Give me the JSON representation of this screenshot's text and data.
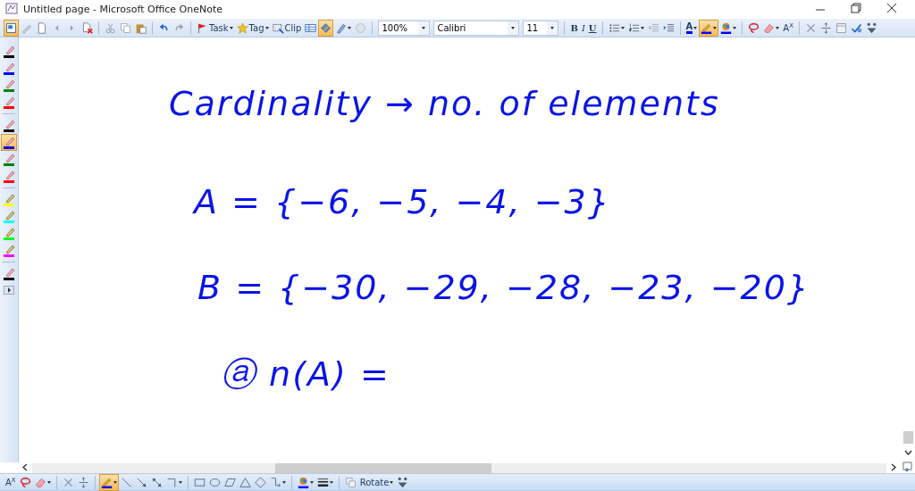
{
  "window": {
    "title": "Untitled page - Microsoft Office OneNote"
  },
  "toolbar": {
    "groups": [
      [
        {
          "kind": "icon",
          "selected": true
        },
        {
          "kind": "icon",
          "selected": false
        },
        {
          "kind": "icon",
          "selected": false
        },
        {
          "kind": "icon",
          "selected": false
        },
        {
          "kind": "icon",
          "selected": false
        },
        {
          "kind": "icon",
          "selected": false
        }
      ],
      [
        {
          "kind": "icon",
          "selected": false
        },
        {
          "kind": "icon",
          "selected": false
        },
        {
          "kind": "icon",
          "selected": false
        }
      ],
      [
        {
          "kind": "icon",
          "selected": false
        },
        {
          "kind": "icon",
          "selected": false
        }
      ],
      [
        {
          "kind": "label-dropdown",
          "label": "Task",
          "selected": false
        },
        {
          "kind": "label-dropdown",
          "label": "Tag",
          "selected": false
        },
        {
          "kind": "label",
          "label": "Clip",
          "selected": false
        },
        {
          "kind": "icon",
          "selected": false
        },
        {
          "kind": "icon",
          "selected": true
        },
        {
          "kind": "icon-dropdown",
          "selected": false
        },
        {
          "kind": "icon",
          "selected": false
        }
      ],
      [
        {
          "kind": "combo",
          "value": "100%"
        },
        {
          "kind": "combo",
          "value": "Calibri"
        },
        {
          "kind": "combo",
          "value": "11"
        }
      ],
      [
        {
          "kind": "format",
          "label": "B",
          "selected": false
        },
        {
          "kind": "format",
          "label": "I",
          "selected": false
        },
        {
          "kind": "format",
          "label": "U",
          "selected": false
        }
      ],
      [
        {
          "kind": "icon-dropdown",
          "selected": false
        },
        {
          "kind": "icon-dropdown",
          "selected": false
        },
        {
          "kind": "icon",
          "selected": false
        },
        {
          "kind": "icon",
          "selected": false
        }
      ],
      [
        {
          "kind": "text-dropdown",
          "label": "A",
          "selected": false
        },
        {
          "kind": "icon-dropdown",
          "selected": true
        },
        {
          "kind": "icon-dropdown",
          "selected": false
        }
      ],
      [
        {
          "kind": "icon",
          "selected": false
        },
        {
          "kind": "icon-dropdown",
          "selected": false
        },
        {
          "kind": "text",
          "label": "A$^{X}$",
          "selected": false
        }
      ],
      [
        {
          "kind": "icon",
          "selected": false
        },
        {
          "kind": "icon",
          "selected": false
        },
        {
          "kind": "icon",
          "selected": false
        },
        {
          "kind": "icon",
          "selected": false
        },
        {
          "kind": "icon",
          "selected": false
        }
      ]
    ]
  },
  "pens": {
    "groups": [
      [
        {
          "kind": "pen",
          "color": "#000000",
          "selected": false
        },
        {
          "kind": "pen",
          "color": "#0000ff",
          "selected": false
        },
        {
          "kind": "pen",
          "color": "#008000",
          "selected": false
        },
        {
          "kind": "pen",
          "color": "#ff0000",
          "selected": false
        }
      ],
      [
        {
          "kind": "pen",
          "color": "#000000",
          "selected": false
        },
        {
          "kind": "pen",
          "color": "#0000ff",
          "selected": true
        },
        {
          "kind": "pen",
          "color": "#008000",
          "selected": false
        },
        {
          "kind": "pen",
          "color": "#ff0000",
          "selected": false
        }
      ],
      [
        {
          "kind": "highlighter",
          "color": "#ffff00",
          "selected": false
        },
        {
          "kind": "highlighter",
          "color": "#00ffff",
          "selected": false
        },
        {
          "kind": "highlighter",
          "color": "#00ff00",
          "selected": false
        },
        {
          "kind": "highlighter",
          "color": "#ff00ff",
          "selected": false
        }
      ],
      [
        {
          "kind": "pen",
          "color": "#000000",
          "selected": false
        }
      ]
    ]
  },
  "ink": [
    {
      "text": "Cardinality → no. of elements"
    },
    {
      "text": "A = {−6, −5, −4, −3}"
    },
    {
      "text": "B = {−30, −29, −28, −23, −20}"
    },
    {
      "text": "ⓐ  n(A) ="
    }
  ],
  "drawing_toolbar": {
    "groups": [
      [
        {
          "kind": "text",
          "label": "A$^{X}$",
          "selected": false
        },
        {
          "kind": "icon",
          "selected": false
        },
        {
          "kind": "icon-dropdown",
          "selected": false
        }
      ],
      [
        {
          "kind": "icon",
          "selected": false
        },
        {
          "kind": "icon",
          "selected": false
        }
      ],
      [
        {
          "kind": "icon-dropdown",
          "selected": true
        },
        {
          "kind": "icon",
          "selected": false
        },
        {
          "kind": "icon",
          "selected": false
        },
        {
          "kind": "icon",
          "selected": false
        },
        {
          "kind": "icon-dropdown",
          "selected": false
        }
      ],
      [
        {
          "kind": "icon",
          "selected": false
        },
        {
          "kind": "icon",
          "selected": false
        },
        {
          "kind": "icon",
          "selected": false
        },
        {
          "kind": "icon",
          "selected": false
        },
        {
          "kind": "icon",
          "selected": false
        },
        {
          "kind": "icon-dropdown",
          "selected": false
        }
      ],
      [
        {
          "kind": "icon-dropdown",
          "selected": false
        },
        {
          "kind": "icon-dropdown",
          "selected": false
        }
      ],
      [
        {
          "kind": "icon",
          "selected": false
        },
        {
          "kind": "label-dropdown",
          "label": "Rotate",
          "selected": false
        },
        {
          "kind": "icon",
          "selected": false
        }
      ]
    ]
  }
}
